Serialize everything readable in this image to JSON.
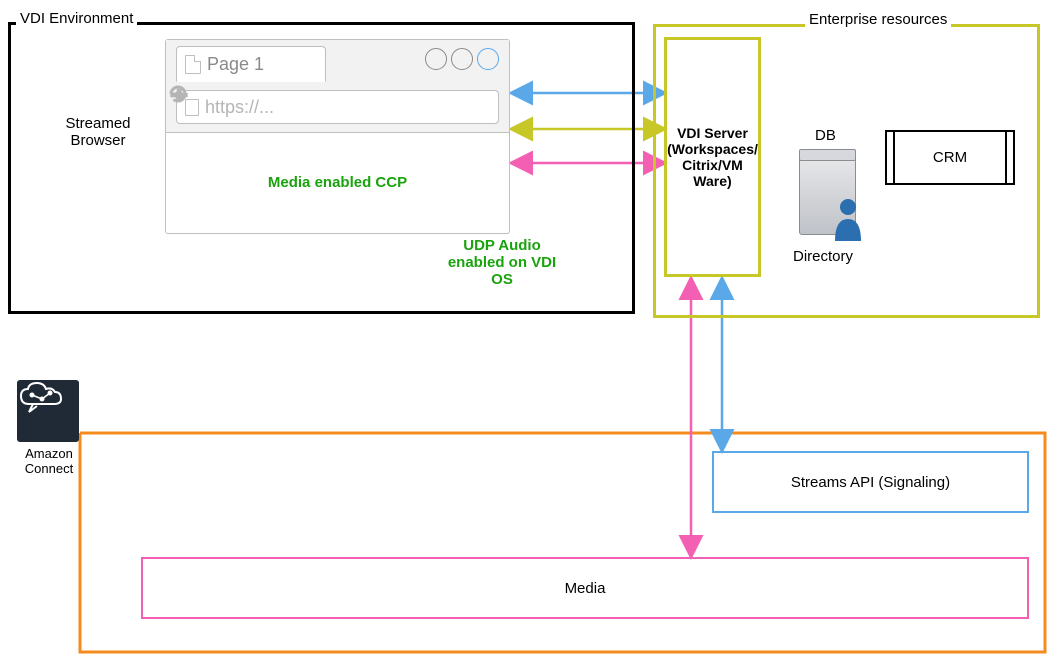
{
  "groups": {
    "vdi_env_title": "VDI Environment",
    "enterprise_title": "Enterprise resources",
    "streamed_browser_label": "Streamed\nBrowser",
    "udp_note": "UDP Audio\nenabled on VDI\nOS"
  },
  "browser": {
    "tab_title": "Page 1",
    "url_placeholder": "https://...",
    "banner": "Media enabled CCP"
  },
  "vdi_server": {
    "label": "VDI Server\n(Workspaces/\nCitrix/VM\nWare)"
  },
  "db": {
    "label": "DB"
  },
  "directory": {
    "label": "Directory"
  },
  "crm": {
    "label": "CRM"
  },
  "amazon_connect": {
    "label": "Amazon\nConnect"
  },
  "streams_api": {
    "label": "Streams API (Signaling)"
  },
  "media": {
    "label": "Media"
  },
  "colors": {
    "black": "#000000",
    "olive": "#c7c727",
    "blue": "#5aa8e8",
    "pink": "#f25fb3",
    "orange": "#f58a1f",
    "grey_bg": "#f2f2f2",
    "grey_line": "#bfbfbf",
    "grey_text": "#b5b5b5",
    "green_text": "#1aa30e",
    "aws_dark": "#1f2a36"
  }
}
